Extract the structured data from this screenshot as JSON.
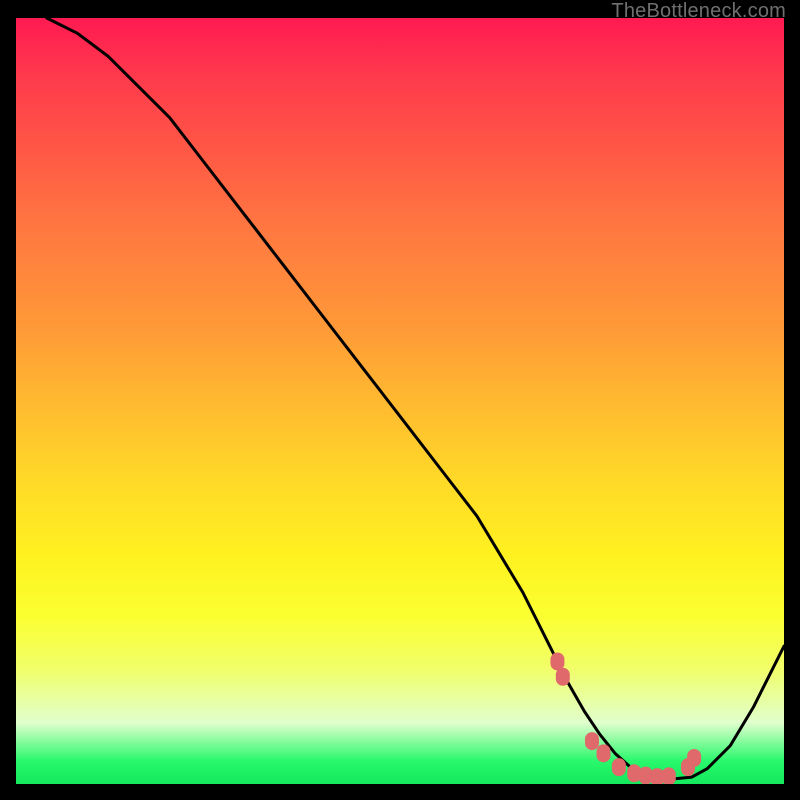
{
  "attribution": "TheBottleneck.com",
  "chart_data": {
    "type": "line",
    "title": "",
    "xlabel": "",
    "ylabel": "",
    "xlim": [
      0,
      100
    ],
    "ylim": [
      0,
      100
    ],
    "series": [
      {
        "name": "curve",
        "x": [
          4,
          8,
          12,
          15,
          20,
          25,
          30,
          35,
          40,
          45,
          50,
          55,
          60,
          63,
          66,
          68,
          70,
          72,
          74,
          76,
          78,
          80,
          82,
          84,
          86,
          88,
          90,
          93,
          96,
          100
        ],
        "y": [
          100,
          98,
          95,
          92,
          87,
          80.5,
          74,
          67.5,
          61,
          54.5,
          48,
          41.5,
          35,
          30,
          25,
          21,
          17,
          13,
          9.5,
          6.5,
          4,
          2.2,
          1.2,
          0.8,
          0.7,
          0.9,
          2,
          5,
          10,
          18
        ]
      }
    ],
    "markers": {
      "name": "highlight-dots",
      "x": [
        70.5,
        71.2,
        75.0,
        76.5,
        78.5,
        80.5,
        82.0,
        83.5,
        85.0,
        87.5,
        88.3
      ],
      "y": [
        16.0,
        14.0,
        5.6,
        4.0,
        2.2,
        1.4,
        1.1,
        0.9,
        1.0,
        2.2,
        3.4
      ]
    }
  }
}
